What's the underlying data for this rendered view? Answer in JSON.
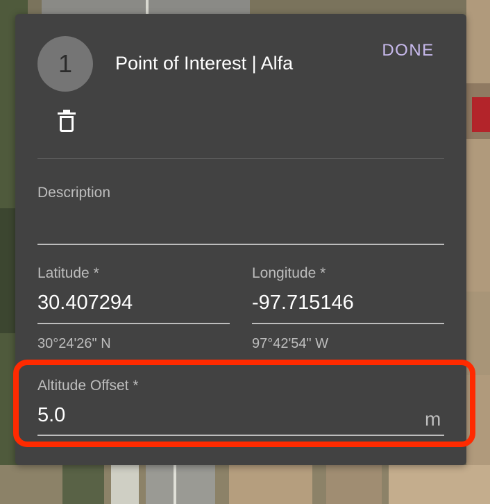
{
  "dialog": {
    "avatar_number": "1",
    "title": "Point of Interest | Alfa",
    "done_label": "DONE",
    "delete_icon": "trash-icon"
  },
  "description": {
    "label": "Description",
    "value": ""
  },
  "latitude": {
    "label": "Latitude *",
    "value": "30.407294",
    "dms": "30°24'26\" N"
  },
  "longitude": {
    "label": "Longitude *",
    "value": "-97.715146",
    "dms": "97°42'54\" W"
  },
  "altitude": {
    "label": "Altitude Offset *",
    "value": "5.0",
    "unit": "m"
  },
  "colors": {
    "panel": "#424242",
    "accent": "#c7b9ec",
    "highlight": "#ff2a00"
  }
}
